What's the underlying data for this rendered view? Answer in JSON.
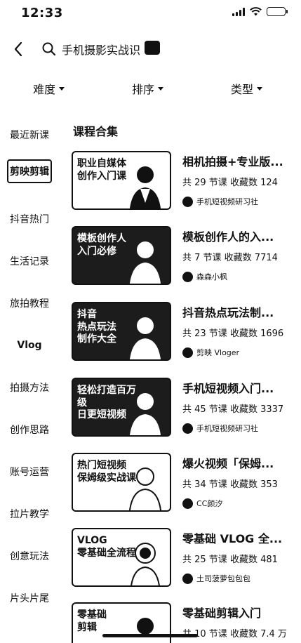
{
  "status": {
    "time": "12:33"
  },
  "search": {
    "query": "手机摄影实战识"
  },
  "filters": [
    {
      "label": "难度"
    },
    {
      "label": "排序"
    },
    {
      "label": "类型"
    }
  ],
  "sidebar": {
    "items": [
      {
        "label": "最近新课"
      },
      {
        "label": "剪映剪辑"
      },
      {
        "label": "抖音热门"
      },
      {
        "label": "生活记录"
      },
      {
        "label": "旅拍教程"
      },
      {
        "label": "Vlog"
      },
      {
        "label": "拍摄方法"
      },
      {
        "label": "创作思路"
      },
      {
        "label": "账号运营"
      },
      {
        "label": "拉片教学"
      },
      {
        "label": "创意玩法"
      },
      {
        "label": "片头片尾"
      }
    ],
    "active_index": 1
  },
  "section": {
    "title": "课程合集"
  },
  "courses": [
    {
      "thumb_text": "职业自媒体\n创作入门课",
      "title": "相机拍摄+专业版...",
      "meta": "共 29 节课 收藏数 124",
      "author": "手机短视频研习社"
    },
    {
      "thumb_text": "模板创作人\n入门必修",
      "title": "模板创作人的入...",
      "meta": "共 7 节课 收藏数 7714",
      "author": "森森小枫"
    },
    {
      "thumb_text": "抖音\n热点玩法\n制作大全",
      "title": "抖音热点玩法制...",
      "meta": "共 23 节课 收藏数 1696",
      "author": "剪映 Vloger"
    },
    {
      "thumb_text": "轻松打造百万级\n日更短视频",
      "title": "手机短视频入门...",
      "meta": "共 45 节课 收藏数 3337",
      "author": "手机短视频研习社"
    },
    {
      "thumb_text": "热门短视频\n保姆级实战课",
      "title": "爆火视频「保姆...",
      "meta": "共 34 节课 收藏数 353",
      "author": "CC颜汐"
    },
    {
      "thumb_text": "VLOG\n零基础全流程",
      "title": "零基础 VLOG 全...",
      "meta": "共 25 节课 收藏数 481",
      "author": "土司菠萝包包包"
    },
    {
      "thumb_text": "零基础\n剪辑",
      "title": "零基础剪辑入门",
      "meta": "共 10 节课 收藏数 7.4 万",
      "author": ""
    }
  ]
}
